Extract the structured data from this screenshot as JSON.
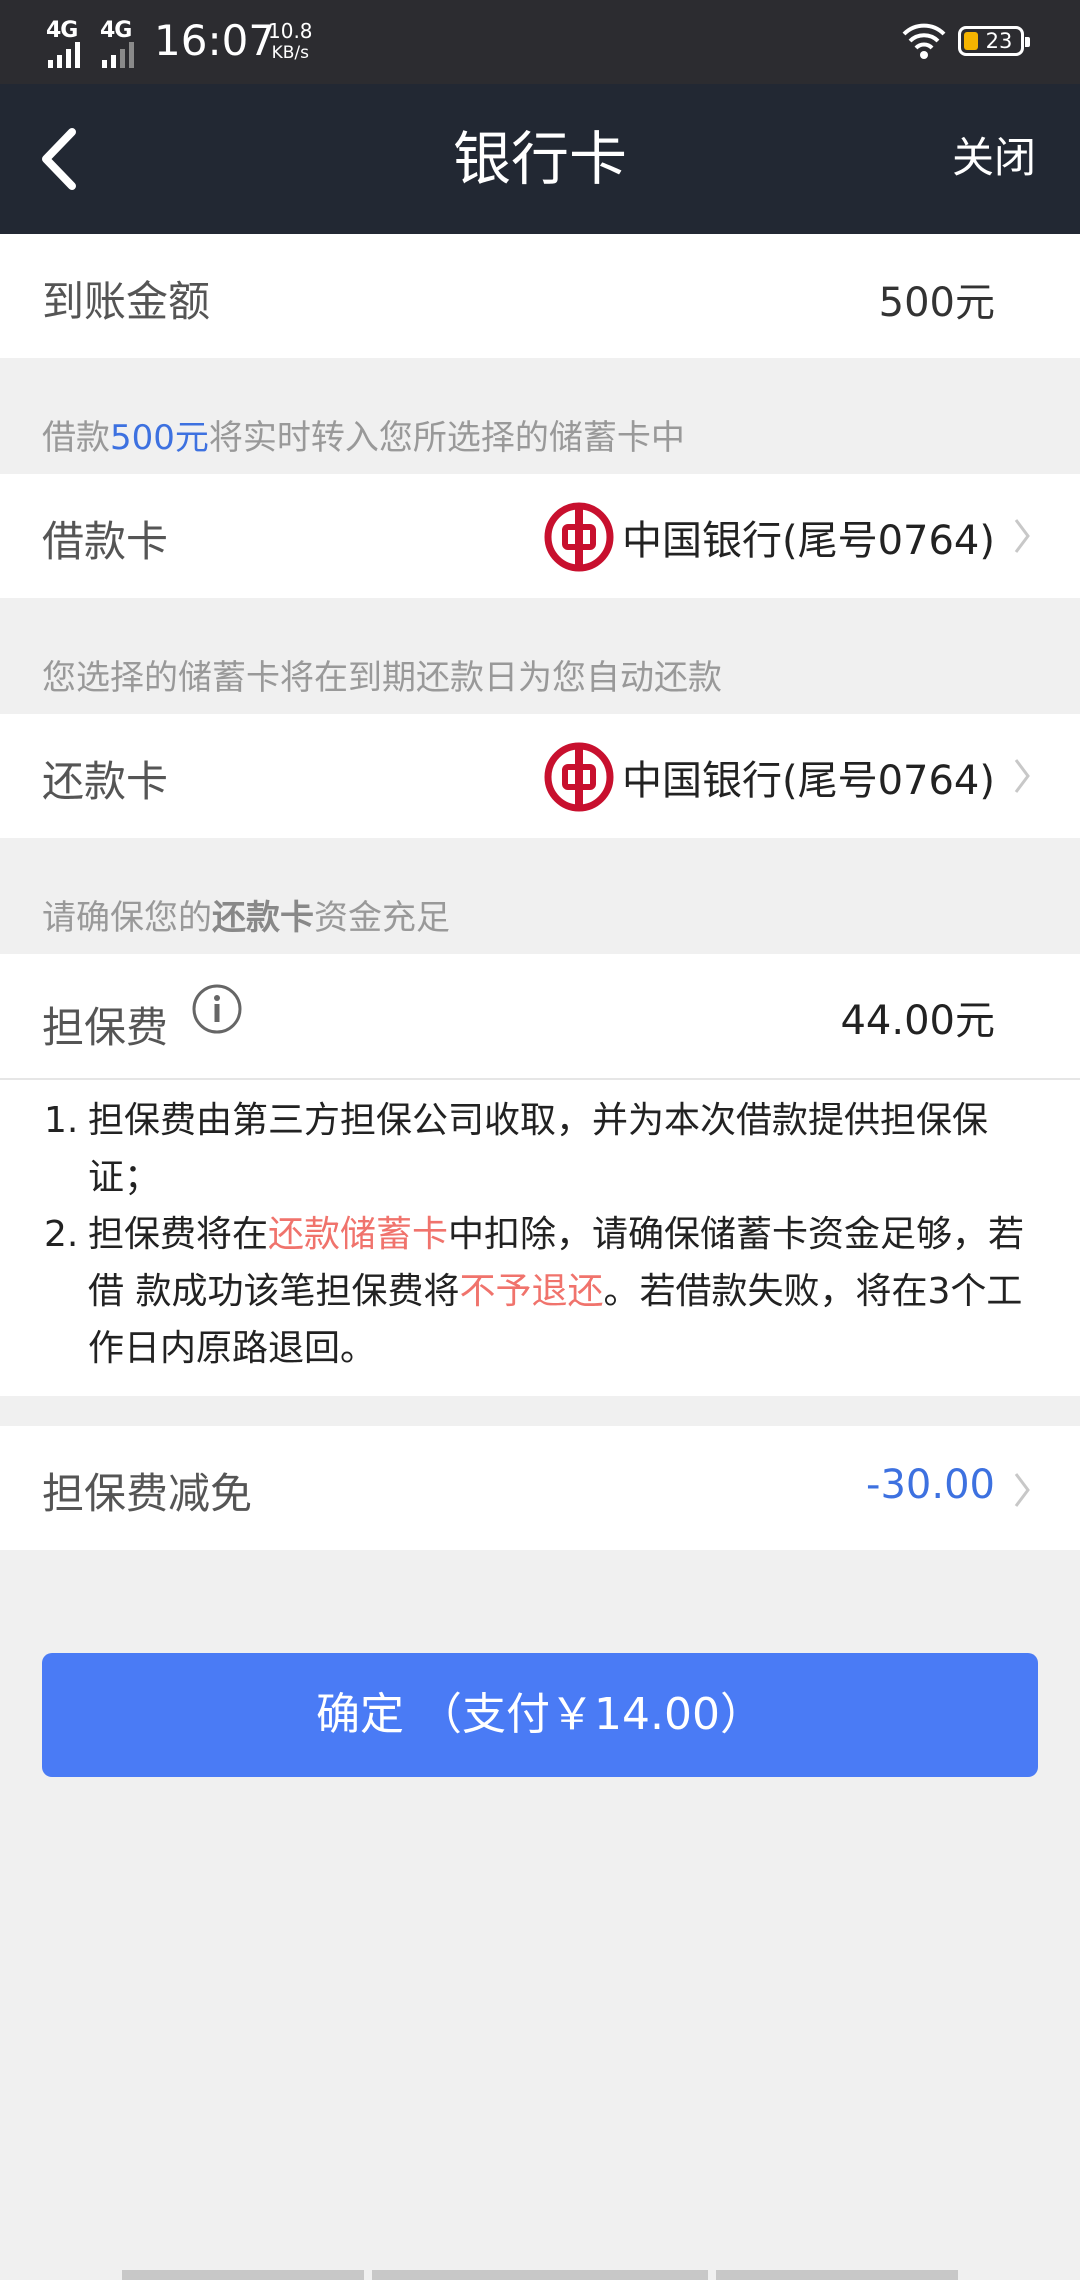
{
  "status_bar": {
    "network_1": "4G",
    "network_2": "4G",
    "time": "16:07",
    "speed_value": "10.8",
    "speed_unit": "KB/s",
    "battery": "23",
    "battery_color": "#f5b400"
  },
  "nav": {
    "back_icon": "chevron-left-icon",
    "title": "银行卡",
    "close_label": "关闭"
  },
  "amount_row": {
    "label": "到账金额",
    "value": "500元"
  },
  "loan_hint": {
    "prefix": "借款",
    "amount": "500元",
    "suffix": "将实时转入您所选择的储蓄卡中"
  },
  "loan_card": {
    "label": "借款卡",
    "bank_name": "中国银行(尾号0764)",
    "bank_icon": "bank-of-china-logo"
  },
  "repay_hint": "您选择的储蓄卡将在到期还款日为您自动还款",
  "repay_card": {
    "label": "还款卡",
    "bank_name": "中国银行(尾号0764)",
    "bank_icon": "bank-of-china-logo"
  },
  "ensure_hint": {
    "prefix": "请确保您的",
    "bold": "还款卡",
    "suffix": "资金充足"
  },
  "guarantee_fee": {
    "label": "担保费",
    "info_icon": "info-icon",
    "value": "44.00元"
  },
  "notes": [
    {
      "num": "1.",
      "text": "担保费由第三方担保公司收取，并为本次借款提供担保保证；"
    },
    {
      "num": "2.",
      "part1": "担保费将在",
      "red1": "还款储蓄卡",
      "part2": "中扣除，请确保储蓄卡资金足够，若借 款成功该笔担保费将",
      "red2": "不予退还",
      "part3": "。若借款失败，将在3个工作日内原路退回。"
    }
  ],
  "fee_discount": {
    "label": "担保费减免",
    "value": "-30.00",
    "value_color": "#3d71e0"
  },
  "confirm_button": "确定 （支付￥14.00）",
  "colors": {
    "nav_bg": "#222833",
    "button": "#4a7bf5",
    "highlight_red": "#f0736c",
    "highlight_blue": "#3d71e0"
  }
}
